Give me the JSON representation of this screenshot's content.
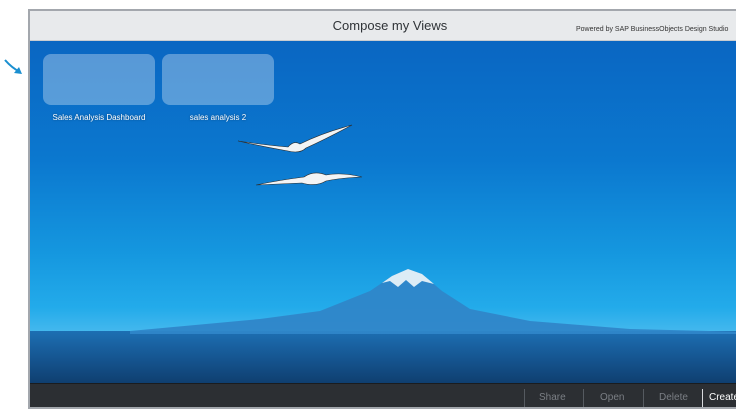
{
  "window": {
    "title": "Compose my Views",
    "powered_by": "Powered by SAP BusinessObjects Design Studio"
  },
  "views": [
    {
      "label": "Sales Analysis Dashboard"
    },
    {
      "label": "sales analysis 2"
    }
  ],
  "toolbar": {
    "share": "Share",
    "open": "Open",
    "delete": "Delete",
    "create": "Create"
  },
  "colors": {
    "sky_top": "#0a66c2",
    "sky_bottom": "#49baee",
    "toolbar_bg": "#2c2f33",
    "annotation_arrow": "#1a8fd0"
  },
  "icons": {
    "annotation": "arrow-icon"
  }
}
